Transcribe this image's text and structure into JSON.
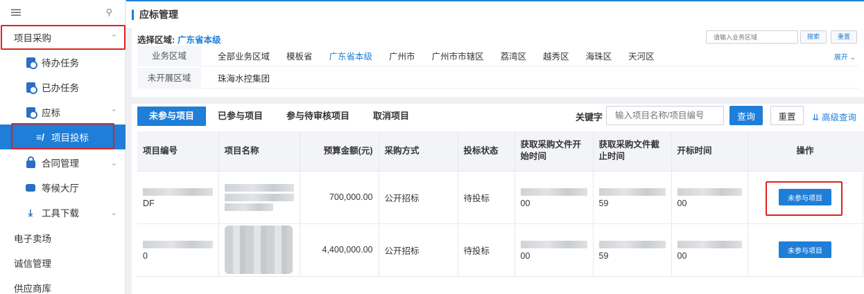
{
  "sidebar": {
    "items": [
      {
        "label": "项目采购",
        "icon": "none"
      },
      {
        "label": "待办任务",
        "icon": "todo-icon"
      },
      {
        "label": "已办任务",
        "icon": "done-icon"
      },
      {
        "label": "应标",
        "icon": "bid-icon"
      },
      {
        "label": "项目投标",
        "icon": "pen-icon"
      },
      {
        "label": "合同管理",
        "icon": "lock-icon"
      },
      {
        "label": "等候大厅",
        "icon": "chat-icon"
      },
      {
        "label": "工具下载",
        "icon": "download-icon"
      },
      {
        "label": "电子卖场"
      },
      {
        "label": "诚信管理"
      },
      {
        "label": "供应商库"
      }
    ]
  },
  "header": {
    "title": "应标管理"
  },
  "region": {
    "select_label": "选择区域:",
    "selected": "广东省本级",
    "search_placeholder": "请输入业务区域",
    "search_btn": "搜索",
    "reset_btn": "重置",
    "expand": "展开",
    "row1_label": "业务区域",
    "row1_options": [
      "全部业务区域",
      "模板省",
      "广东省本级",
      "广州市",
      "广州市市辖区",
      "荔湾区",
      "越秀区",
      "海珠区",
      "天河区"
    ],
    "row2_label": "未开展区域",
    "row2_options": [
      "珠海水控集团"
    ]
  },
  "main": {
    "tabs": [
      "未参与项目",
      "已参与项目",
      "参与待审核项目",
      "取消项目"
    ],
    "keyword_label": "关键字",
    "keyword_placeholder": "输入项目名称/项目编号",
    "query_btn": "查询",
    "reset_btn": "重置",
    "advanced": "高级查询"
  },
  "table": {
    "headers": [
      "项目编号",
      "项目名称",
      "预算金额(元)",
      "采购方式",
      "投标状态",
      "获取采购文件开始时间",
      "获取采购文件截止时间",
      "开标时间",
      "操作"
    ],
    "rows": [
      {
        "code_suffix": "DF",
        "amount": "700,000.00",
        "method": "公开招标",
        "status": "待投标",
        "start_suffix": "00",
        "end_suffix": "59",
        "open_suffix": "00",
        "action": "未参与项目"
      },
      {
        "code_suffix": "0",
        "amount": "4,400,000.00",
        "method": "公开招标",
        "status": "待投标",
        "start_suffix": "00",
        "end_suffix": "59",
        "open_suffix": "00",
        "action": "未参与项目"
      }
    ]
  },
  "colors": {
    "accent": "#1e7ed8",
    "highlight": "#e0201a"
  }
}
